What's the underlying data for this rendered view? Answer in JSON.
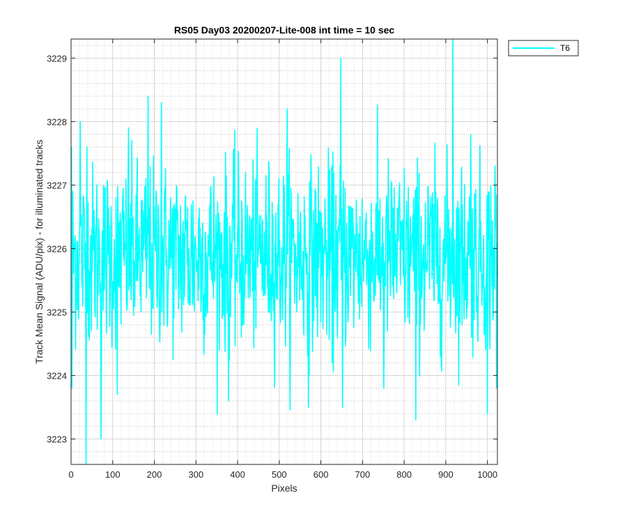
{
  "chart_data": {
    "type": "line",
    "title": "RS05 Day03 20200207-Lite-008 int time = 10 sec",
    "xlabel": "Pixels",
    "ylabel": "Track Mean Signal (ADU/pix) - for illuminated tracks",
    "xlim": [
      0,
      1024
    ],
    "ylim": [
      3222.6,
      3229.3
    ],
    "xticks": [
      0,
      100,
      200,
      300,
      400,
      500,
      600,
      700,
      800,
      900,
      1000
    ],
    "yticks": [
      3223,
      3224,
      3225,
      3226,
      3227,
      3228,
      3229
    ],
    "grid": "major and minor",
    "legend_location": "outside-top-right",
    "series": [
      {
        "name": "T6",
        "color": "#00FFFF",
        "x_start": 1,
        "x_step": 1,
        "count": 1024,
        "baseline": 3225.9,
        "noise_std": 0.72,
        "min": 3222.6,
        "max": 3229.3,
        "notable_points": [
          {
            "x": 1,
            "y": 3227.6
          },
          {
            "x": 2,
            "y": 3223.8
          },
          {
            "x": 22,
            "y": 3228.0
          },
          {
            "x": 36,
            "y": 3222.6
          },
          {
            "x": 38,
            "y": 3227.6
          },
          {
            "x": 72,
            "y": 3223.0
          },
          {
            "x": 111,
            "y": 3223.7
          },
          {
            "x": 138,
            "y": 3227.9
          },
          {
            "x": 185,
            "y": 3228.4
          },
          {
            "x": 217,
            "y": 3228.3
          },
          {
            "x": 378,
            "y": 3223.6
          },
          {
            "x": 519,
            "y": 3228.2
          },
          {
            "x": 570,
            "y": 3223.5
          },
          {
            "x": 627,
            "y": 3224.2
          },
          {
            "x": 648,
            "y": 3229.0
          },
          {
            "x": 652,
            "y": 3223.5
          },
          {
            "x": 751,
            "y": 3223.8
          },
          {
            "x": 828,
            "y": 3223.3
          },
          {
            "x": 917,
            "y": 3229.3
          },
          {
            "x": 960,
            "y": 3227.8
          },
          {
            "x": 1000,
            "y": 3223.4
          },
          {
            "x": 1018,
            "y": 3227.3
          },
          {
            "x": 1022,
            "y": 3223.8
          }
        ]
      }
    ]
  }
}
